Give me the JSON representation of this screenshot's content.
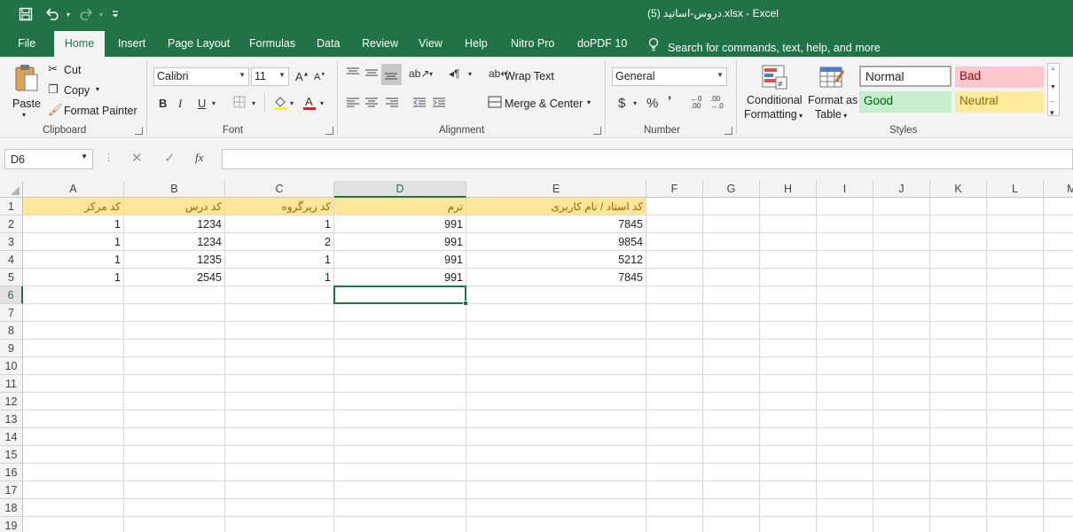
{
  "window": {
    "title": "دروس-اساتید (5).xlsx  -  Excel"
  },
  "quick_access": {
    "icons": [
      "save-icon",
      "undo-icon",
      "redo-icon",
      "customize-icon"
    ]
  },
  "ribbon_tabs": [
    {
      "label": "File"
    },
    {
      "label": "Home"
    },
    {
      "label": "Insert"
    },
    {
      "label": "Page Layout"
    },
    {
      "label": "Formulas"
    },
    {
      "label": "Data"
    },
    {
      "label": "Review"
    },
    {
      "label": "View"
    },
    {
      "label": "Help"
    },
    {
      "label": "Nitro Pro"
    },
    {
      "label": "doPDF 10"
    }
  ],
  "tell_me": {
    "placeholder": "Search for commands, text, help, and more",
    "icon": "lightbulb-icon"
  },
  "clipboard": {
    "paste": "Paste",
    "cut": "Cut",
    "copy": "Copy",
    "format_painter": "Format Painter",
    "group": "Clipboard"
  },
  "font": {
    "name": "Calibri",
    "size": "11",
    "bold": "B",
    "italic": "I",
    "underline": "U",
    "group": "Font"
  },
  "alignment": {
    "wrap_text": "Wrap Text",
    "merge_center": "Merge & Center",
    "group": "Alignment"
  },
  "number": {
    "format": "General",
    "currency": "$",
    "percent": "%",
    "comma": "ʼ",
    "group": "Number"
  },
  "styles": {
    "conditional_formatting_1": "Conditional",
    "conditional_formatting_2": "Formatting",
    "format_as_table_1": "Format as",
    "format_as_table_2": "Table",
    "normal": "Normal",
    "bad": "Bad",
    "good": "Good",
    "neutral": "Neutral",
    "group": "Styles",
    "colors": {
      "normal_bg": "#ffffff",
      "bad_bg": "#ffc7ce",
      "bad_fg": "#9c0006",
      "good_bg": "#c6efce",
      "good_fg": "#006100",
      "neutral_bg": "#ffeb9c",
      "neutral_fg": "#9c6500"
    }
  },
  "formula_bar": {
    "name_box": "D6",
    "fx": "fx",
    "value": ""
  },
  "sheet": {
    "columns": [
      "A",
      "B",
      "C",
      "D",
      "E",
      "F",
      "G",
      "H",
      "I",
      "J",
      "K",
      "L",
      "M"
    ],
    "row_numbers": [
      "1",
      "2",
      "3",
      "4",
      "5",
      "6",
      "7",
      "8",
      "9",
      "10",
      "11",
      "12",
      "13",
      "14",
      "15",
      "16",
      "17",
      "18",
      "19"
    ],
    "active_cell": "D6",
    "headers": [
      "کد مرکز",
      "کد درس",
      "کد زیرگروه",
      "ترم",
      "کد  استاد / نام کاربری"
    ],
    "rows": [
      [
        "1",
        "1234",
        "1",
        "991",
        "7845"
      ],
      [
        "1",
        "1234",
        "2",
        "991",
        "9854"
      ],
      [
        "1",
        "1235",
        "1",
        "991",
        "5212"
      ],
      [
        "1",
        "2545",
        "1",
        "991",
        "7845"
      ]
    ],
    "header_fill": "#ffe699",
    "accent": "#217346"
  }
}
